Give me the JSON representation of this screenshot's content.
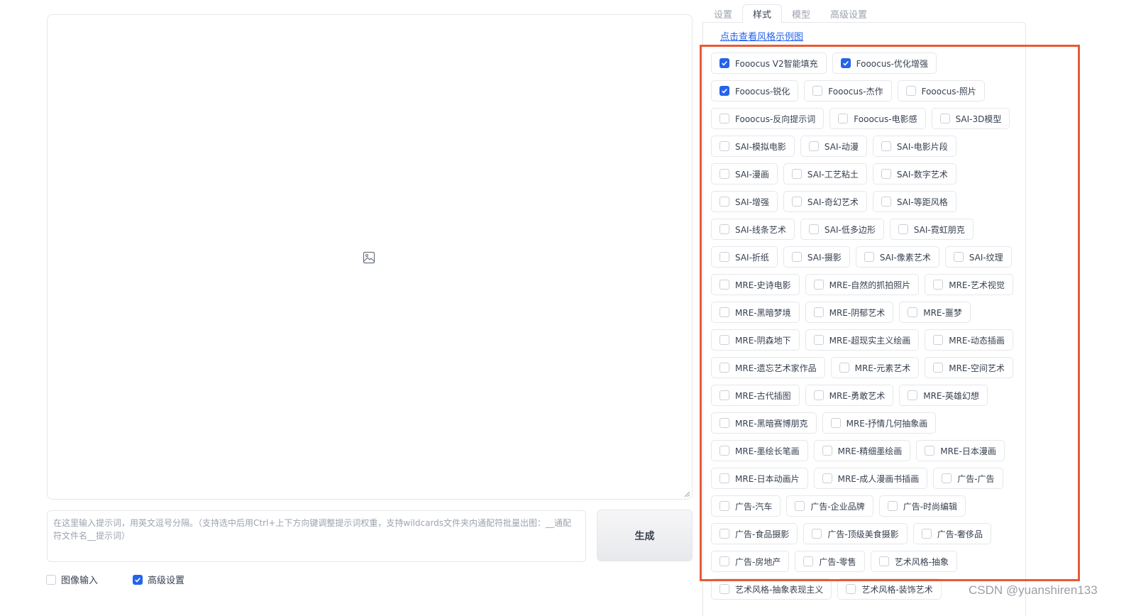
{
  "tabs": [
    "设置",
    "样式",
    "模型",
    "高级设置"
  ],
  "active_tab": "样式",
  "style_link": "点击查看风格示例图",
  "prompt": {
    "placeholder": "在这里输入提示词，用英文逗号分隔。（支持选中后用Ctrl+上下方向键调整提示词权重，支持wildcards文件夹内通配符批量出图：__通配符文件名__提示词）"
  },
  "generate_label": "生成",
  "bottom": {
    "image_input": {
      "label": "图像输入",
      "checked": false
    },
    "advanced": {
      "label": "高级设置",
      "checked": true
    }
  },
  "styles": [
    {
      "label": "Fooocus V2智能填充",
      "checked": true
    },
    {
      "label": "Fooocus-优化增强",
      "checked": true
    },
    {
      "label": "Fooocus-锐化",
      "checked": true
    },
    {
      "label": "Fooocus-杰作",
      "checked": false
    },
    {
      "label": "Fooocus-照片",
      "checked": false
    },
    {
      "label": "Fooocus-反向提示词",
      "checked": false
    },
    {
      "label": "Fooocus-电影感",
      "checked": false
    },
    {
      "label": "SAI-3D模型",
      "checked": false
    },
    {
      "label": "SAI-模拟电影",
      "checked": false
    },
    {
      "label": "SAI-动漫",
      "checked": false
    },
    {
      "label": "SAI-电影片段",
      "checked": false
    },
    {
      "label": "SAI-漫画",
      "checked": false
    },
    {
      "label": "SAI-工艺粘土",
      "checked": false
    },
    {
      "label": "SAI-数字艺术",
      "checked": false
    },
    {
      "label": "SAI-增强",
      "checked": false
    },
    {
      "label": "SAI-奇幻艺术",
      "checked": false
    },
    {
      "label": "SAI-等距风格",
      "checked": false
    },
    {
      "label": "SAI-线条艺术",
      "checked": false
    },
    {
      "label": "SAI-低多边形",
      "checked": false
    },
    {
      "label": "SAI-霓虹朋克",
      "checked": false
    },
    {
      "label": "SAI-折纸",
      "checked": false
    },
    {
      "label": "SAI-摄影",
      "checked": false
    },
    {
      "label": "SAI-像素艺术",
      "checked": false
    },
    {
      "label": "SAI-纹理",
      "checked": false
    },
    {
      "label": "MRE-史诗电影",
      "checked": false
    },
    {
      "label": "MRE-自然的抓拍照片",
      "checked": false
    },
    {
      "label": "MRE-艺术视觉",
      "checked": false
    },
    {
      "label": "MRE-黑暗梦境",
      "checked": false
    },
    {
      "label": "MRE-阴郁艺术",
      "checked": false
    },
    {
      "label": "MRE-噩梦",
      "checked": false
    },
    {
      "label": "MRE-阴森地下",
      "checked": false
    },
    {
      "label": "MRE-超现实主义绘画",
      "checked": false
    },
    {
      "label": "MRE-动态插画",
      "checked": false
    },
    {
      "label": "MRE-遗忘艺术家作品",
      "checked": false
    },
    {
      "label": "MRE-元素艺术",
      "checked": false
    },
    {
      "label": "MRE-空间艺术",
      "checked": false
    },
    {
      "label": "MRE-古代插图",
      "checked": false
    },
    {
      "label": "MRE-勇敢艺术",
      "checked": false
    },
    {
      "label": "MRE-英雄幻想",
      "checked": false
    },
    {
      "label": "MRE-黑暗赛博朋克",
      "checked": false
    },
    {
      "label": "MRE-抒情几何抽象画",
      "checked": false
    },
    {
      "label": "MRE-墨绘长笔画",
      "checked": false
    },
    {
      "label": "MRE-精细墨绘画",
      "checked": false
    },
    {
      "label": "MRE-日本漫画",
      "checked": false
    },
    {
      "label": "MRE-日本动画片",
      "checked": false
    },
    {
      "label": "MRE-成人漫画书插画",
      "checked": false
    },
    {
      "label": "广告-广告",
      "checked": false
    },
    {
      "label": "广告-汽车",
      "checked": false
    },
    {
      "label": "广告-企业品牌",
      "checked": false
    },
    {
      "label": "广告-时尚编辑",
      "checked": false
    },
    {
      "label": "广告-食品摄影",
      "checked": false
    },
    {
      "label": "广告-顶级美食摄影",
      "checked": false
    },
    {
      "label": "广告-奢侈品",
      "checked": false
    },
    {
      "label": "广告-房地产",
      "checked": false
    },
    {
      "label": "广告-零售",
      "checked": false
    },
    {
      "label": "艺术风格-抽象",
      "checked": false
    },
    {
      "label": "艺术风格-抽象表现主义",
      "checked": false
    },
    {
      "label": "艺术风格-装饰艺术",
      "checked": false
    }
  ],
  "watermark": "CSDN @yuanshiren133",
  "colors": {
    "accent": "#2563eb",
    "highlight_box": "#e85a35"
  }
}
